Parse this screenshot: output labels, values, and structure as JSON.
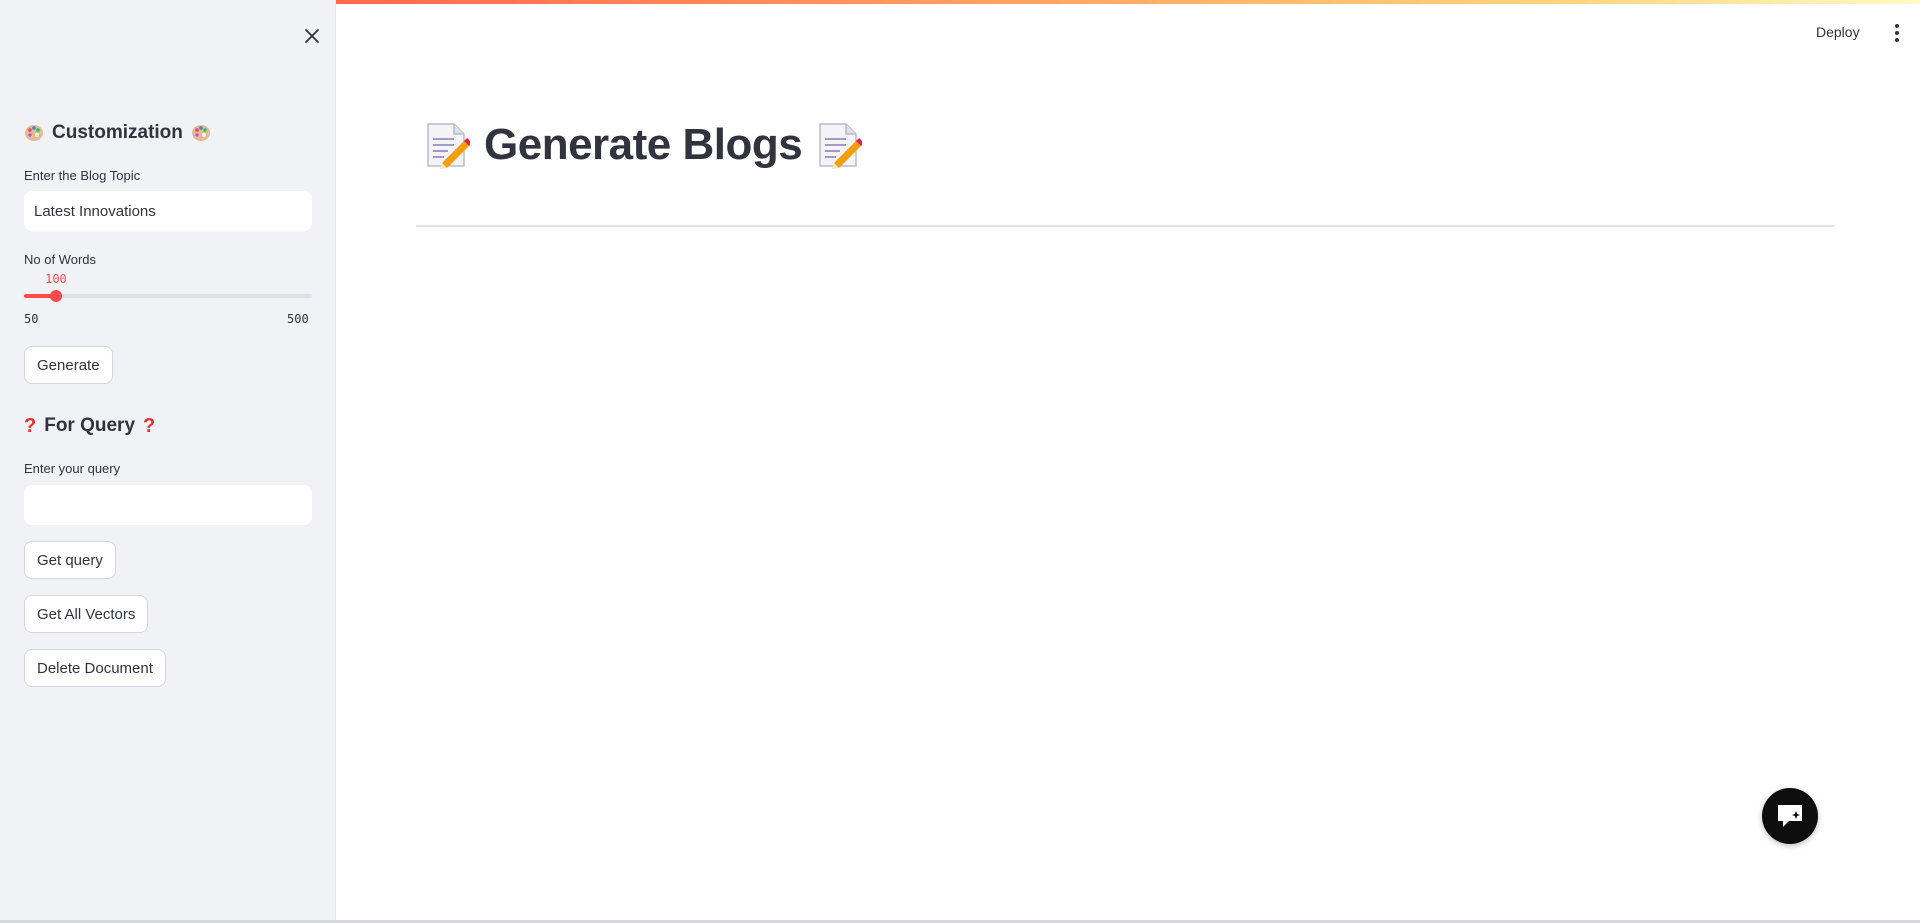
{
  "header": {
    "deploy_label": "Deploy"
  },
  "sidebar": {
    "customization": {
      "heading": "Customization"
    },
    "blog_topic": {
      "label": "Enter the Blog Topic",
      "value": "Latest Innovations"
    },
    "word_slider": {
      "label": "No of Words",
      "value": "100",
      "min": "50",
      "max": "500",
      "fraction": 0.111
    },
    "generate_button": "Generate",
    "query": {
      "heading": "For Query",
      "label": "Enter your query",
      "value": ""
    },
    "get_query_button": "Get query",
    "get_all_vectors_button": "Get All Vectors",
    "delete_document_button": "Delete Document"
  },
  "main": {
    "title": "Generate Blogs"
  },
  "colors": {
    "accent": "#ff4b4b",
    "sidebar_bg": "#f0f2f6",
    "text": "#31333f"
  },
  "icons": {
    "close": "close-icon",
    "palette": "palette-icon",
    "question": "question-mark-icon",
    "memo": "memo-icon",
    "menu": "kebab-menu-icon",
    "chat": "chat-bubble-icon"
  }
}
